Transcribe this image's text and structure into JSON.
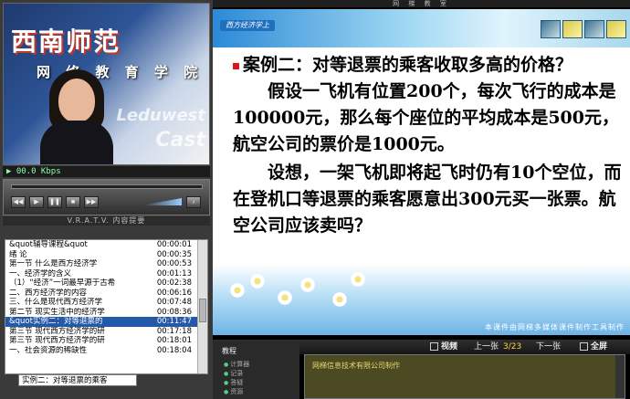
{
  "window": {
    "title": "网 梯 教 室"
  },
  "video": {
    "title_text": "西南师范",
    "subtitle_text": "网 络 教 育 学 院",
    "watermark_top": "Leduwest",
    "watermark_bottom": "Cast",
    "status": "00.0 Kbps",
    "progress_fraction": 0.0
  },
  "player": {
    "brand": "V.R.A.T.V.",
    "summary_label": "内容提要"
  },
  "outline": {
    "items": [
      {
        "label": "&quot辅导课程&quot",
        "time": "00:00:01",
        "selected": false
      },
      {
        "label": "绪  论",
        "time": "00:00:35",
        "selected": false
      },
      {
        "label": "第一节  什么是西方经济学",
        "time": "00:00:53",
        "selected": false
      },
      {
        "label": "一、经济学的含义",
        "time": "00:01:13",
        "selected": false
      },
      {
        "label": "（1）“经济”一词最早源于古希",
        "time": "00:02:38",
        "selected": false
      },
      {
        "label": "二、西方经济学的内容",
        "time": "00:06:16",
        "selected": false
      },
      {
        "label": "三、什么是现代西方经济学",
        "time": "00:07:48",
        "selected": false
      },
      {
        "label": "第二节  现实生活中的经济学",
        "time": "00:08:36",
        "selected": false
      },
      {
        "label": "&quot实例二：对等退票的",
        "time": "00:11:47",
        "selected": true
      },
      {
        "label": "第三节  现代西方经济学的研",
        "time": "00:17:18",
        "selected": false
      },
      {
        "label": "第三节  现代西方经济学的研",
        "time": "00:18:01",
        "selected": false
      },
      {
        "label": "一、社会资源的稀缺性",
        "time": "00:18:04",
        "selected": false
      }
    ],
    "current": "实例二：对等退票的乘客"
  },
  "slide": {
    "course_tag": "西方经济学上",
    "title": "案例二：对等退票的乘客收取多高的价格？",
    "paragraph1": "假设一飞机有位置200个，每次飞行的成本是100000元，那么每个座位的平均成本是500元，航空公司的票价是1000元。",
    "paragraph2": "设想，一架飞机即将起飞时仍有10个空位，而在登机口等退票的乘客愿意出300元买一张票。航空公司应该卖吗？",
    "credit": "本课件由网梯多媒体课件制作工具制作"
  },
  "nav": {
    "view_label": "视频",
    "prev_label": "上一张",
    "page": "3/23",
    "next_label": "下一张",
    "fullscreen_label": "全屏"
  },
  "notes": {
    "label": "教程",
    "rows": [
      "计算器",
      "记录",
      "答疑",
      "资源"
    ],
    "company": "网梯信息技术有限公司制作"
  },
  "colors": {
    "selection": "#2458a8",
    "accent_red": "#d7191c",
    "header_blue": "#2b8ad6"
  }
}
